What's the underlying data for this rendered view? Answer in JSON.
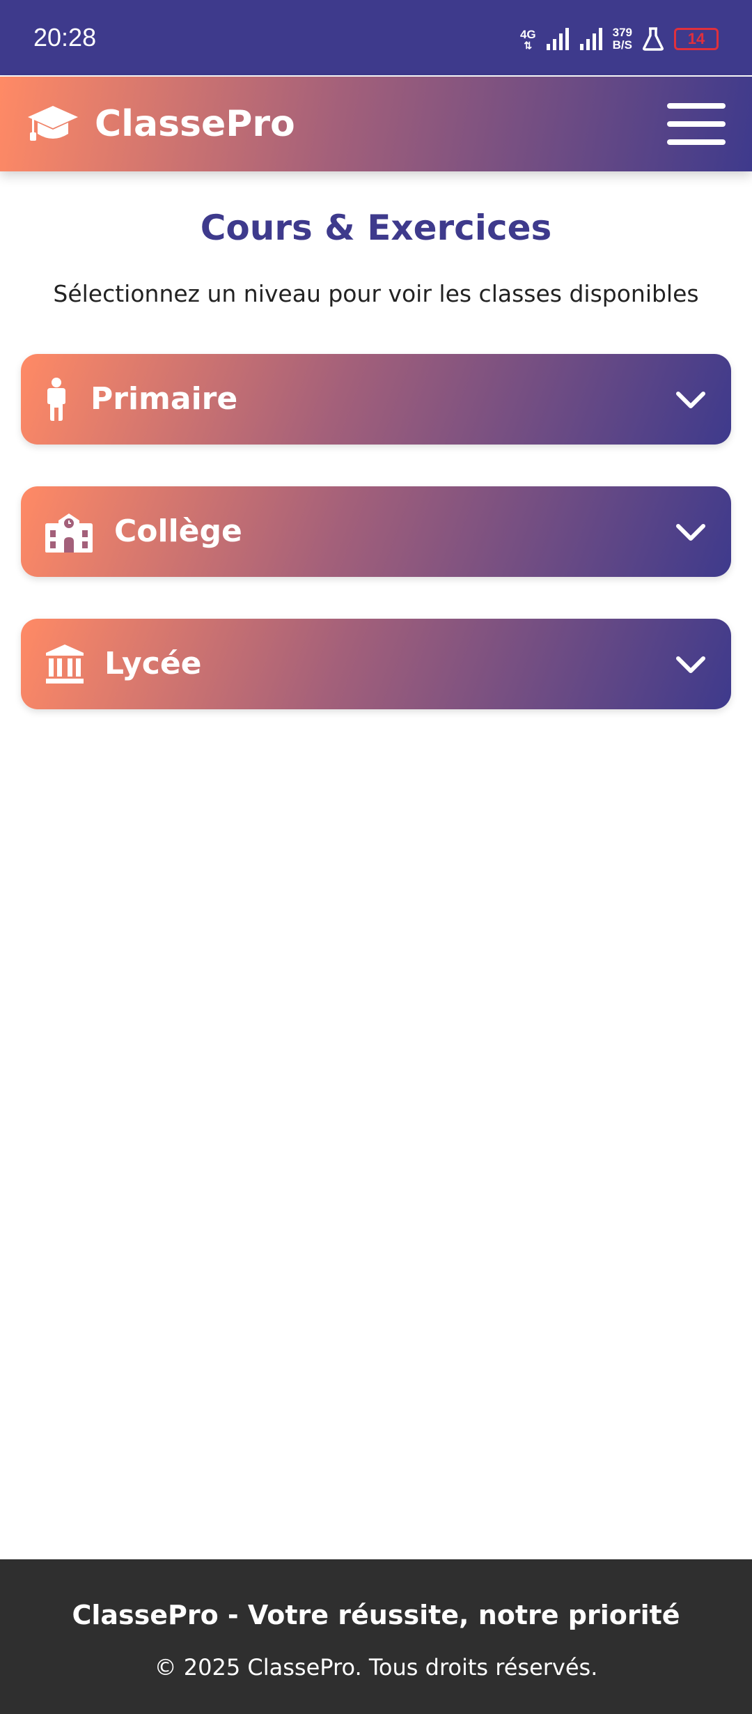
{
  "status_bar": {
    "time": "20:28",
    "network_type": "4G",
    "net_speed_value": "379",
    "net_speed_unit": "B/S",
    "battery_level": "14",
    "icons": [
      "data-arrows-icon",
      "signal-icon",
      "signal-icon",
      "lab-flask-icon",
      "battery-icon"
    ]
  },
  "header": {
    "logo_icon": "graduation-cap-icon",
    "app_name": "ClassePro",
    "menu_icon": "hamburger-menu-icon"
  },
  "main": {
    "title": "Cours & Exercices",
    "subtitle": "Sélectionnez un niveau pour voir les classes disponibles",
    "levels": [
      {
        "label": "Primaire",
        "icon": "child-icon"
      },
      {
        "label": "Collège",
        "icon": "school-building-icon"
      },
      {
        "label": "Lycée",
        "icon": "institution-icon"
      }
    ]
  },
  "footer": {
    "tagline": "ClassePro - Votre réussite, notre priorité",
    "copyright": "© 2025 ClassePro. Tous droits réservés."
  },
  "colors": {
    "primary": "#3e3a8c",
    "accent": "#ff8a65",
    "footer_bg": "#2f2f2f",
    "battery_low": "#e0303c"
  }
}
